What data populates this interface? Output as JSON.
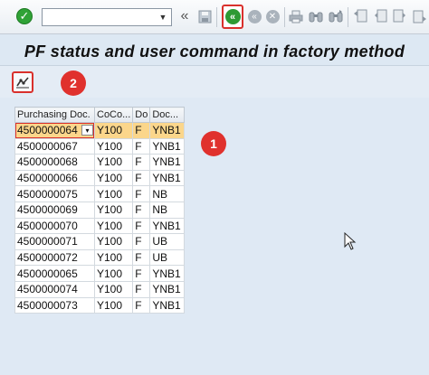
{
  "toolbar": {
    "command_field": {
      "value": "",
      "placeholder": ""
    },
    "back_label": "«",
    "icons": [
      "enter-icon",
      "save-icon",
      "back-icon",
      "exit-icon",
      "cancel-icon",
      "print-icon",
      "find-icon",
      "find-next-icon",
      "first-page-icon",
      "previous-page-icon",
      "next-page-icon",
      "last-page-icon"
    ]
  },
  "title": "PF status and user command in factory method",
  "app_toolbar": {
    "custom_button_icon": "custom-function-icon"
  },
  "markers": {
    "one": "1",
    "two": "2"
  },
  "grid": {
    "columns": [
      "Purchasing Doc.",
      "CoCo...",
      "Do",
      "Doc..."
    ],
    "rows": [
      [
        "4500000064",
        "Y100",
        "F",
        "YNB1"
      ],
      [
        "4500000067",
        "Y100",
        "F",
        "YNB1"
      ],
      [
        "4500000068",
        "Y100",
        "F",
        "YNB1"
      ],
      [
        "4500000066",
        "Y100",
        "F",
        "YNB1"
      ],
      [
        "4500000075",
        "Y100",
        "F",
        "NB"
      ],
      [
        "4500000069",
        "Y100",
        "F",
        "NB"
      ],
      [
        "4500000070",
        "Y100",
        "F",
        "YNB1"
      ],
      [
        "4500000071",
        "Y100",
        "F",
        "UB"
      ],
      [
        "4500000072",
        "Y100",
        "F",
        "UB"
      ],
      [
        "4500000065",
        "Y100",
        "F",
        "YNB1"
      ],
      [
        "4500000074",
        "Y100",
        "F",
        "YNB1"
      ],
      [
        "4500000073",
        "Y100",
        "F",
        "YNB1"
      ]
    ]
  },
  "colors": {
    "highlight": "#d9302c",
    "selected_row": "#fbd68b",
    "ok_green": "#2fa236"
  }
}
